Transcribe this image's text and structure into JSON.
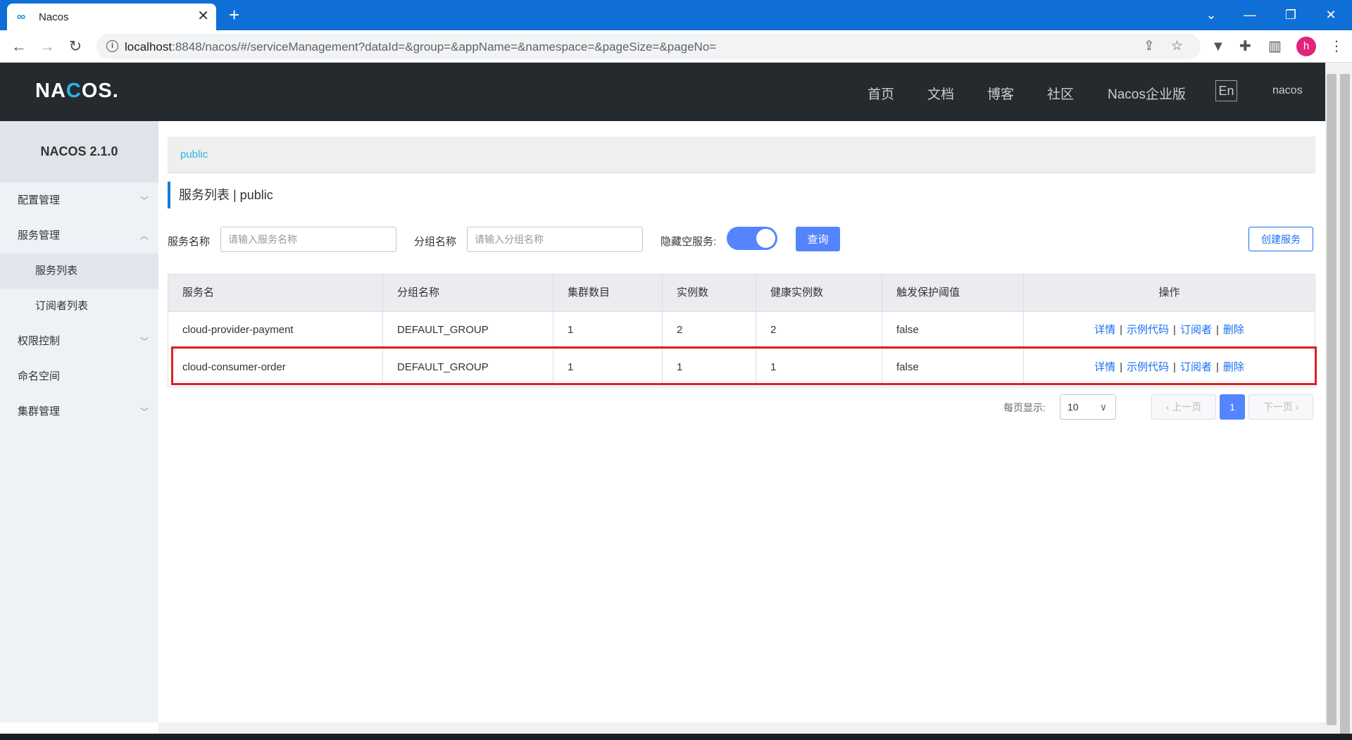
{
  "browser": {
    "tab_title": "Nacos",
    "tab_close": "✕",
    "new_tab": "+",
    "url_host": "localhost",
    "url_path": ":8848/nacos/#/serviceManagement?dataId=&group=&appName=&namespace=&pageSize=&pageNo=",
    "profile_initial": "h",
    "icons": [
      "back-arrow-icon",
      "forward-arrow-icon",
      "reload-icon",
      "info-icon",
      "share-icon",
      "star-icon",
      "extension-v-icon",
      "puzzle-icon",
      "sidepanel-icon",
      "menu-dots-icon"
    ]
  },
  "header": {
    "logo_pre": "NA",
    "logo_mid": "C",
    "logo_post": "OS.",
    "nav": [
      "首页",
      "文档",
      "博客",
      "社区",
      "Nacos企业版"
    ],
    "lang": "En",
    "user": "nacos"
  },
  "sidebar": {
    "version": "NACOS 2.1.0",
    "items": [
      {
        "label": "配置管理",
        "chevron": "﹀"
      },
      {
        "label": "服务管理",
        "chevron": "︿"
      },
      {
        "label": "服务列表"
      },
      {
        "label": "订阅者列表"
      },
      {
        "label": "权限控制",
        "chevron": "﹀"
      },
      {
        "label": "命名空间"
      },
      {
        "label": "集群管理",
        "chevron": "﹀"
      }
    ]
  },
  "main": {
    "namespace": "public",
    "page_title": "服务列表  |  public",
    "filters": {
      "service_label": "服务名称",
      "service_placeholder": "请输入服务名称",
      "group_label": "分组名称",
      "group_placeholder": "请输入分组名称",
      "hide_empty_label": "隐藏空服务:",
      "hide_empty_on": true,
      "query_button": "查询",
      "create_button": "创建服务"
    },
    "table": {
      "columns": [
        "服务名",
        "分组名称",
        "集群数目",
        "实例数",
        "健康实例数",
        "触发保护阈值",
        "操作"
      ],
      "rows": [
        {
          "name": "cloud-provider-payment",
          "group": "DEFAULT_GROUP",
          "clusters": "1",
          "instances": "2",
          "healthy": "2",
          "threshold": "false"
        },
        {
          "name": "cloud-consumer-order",
          "group": "DEFAULT_GROUP",
          "clusters": "1",
          "instances": "1",
          "healthy": "1",
          "threshold": "false"
        }
      ],
      "ops": {
        "detail": "详情",
        "sample": "示例代码",
        "subscriber": "订阅者",
        "delete": "删除",
        "sep": "|"
      }
    },
    "pager": {
      "per_page_label": "每页显示:",
      "per_page_value": "10",
      "prev": "‹ 上一页",
      "current": "1",
      "next": "下一页 ›"
    }
  },
  "colors": {
    "header_bg": "#252a2f",
    "primary": "#5584ff",
    "link": "#1a6ff2",
    "highlight": "#e02020",
    "browser_blue": "#0f6fd6"
  }
}
